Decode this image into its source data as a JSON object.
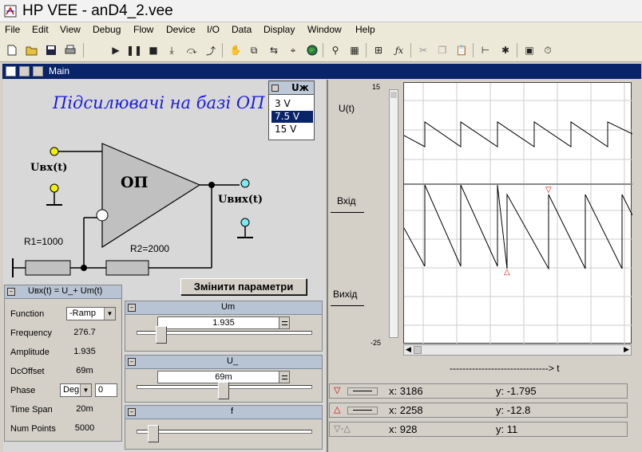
{
  "app": {
    "title": "HP VEE - anD4_2.vee"
  },
  "menu": [
    "File",
    "Edit",
    "View",
    "Debug",
    "Flow",
    "Device",
    "I/O",
    "Data",
    "Display",
    "Window",
    "Help"
  ],
  "window": {
    "title": "Main"
  },
  "schematic": {
    "title": "Підсилювачі на базі ОП",
    "opamp_label": "ОП",
    "uin_label": "Uвх(t)",
    "uout_label": "Uвих(t)",
    "r1_label": "R1=1000",
    "r2_label": "R2=2000"
  },
  "listbox": {
    "title": "Uж",
    "options": [
      "3 V",
      "7.5 V",
      "15 V"
    ],
    "selected": "7.5 V"
  },
  "change_button": "Змінити параметри",
  "function_gen": {
    "title": "Uвх(t) = U_+ Um(t)",
    "rows": [
      {
        "label": "Function",
        "value": "-Ramp"
      },
      {
        "label": "Frequency",
        "value": "276.7"
      },
      {
        "label": "Amplitude",
        "value": "1.935"
      },
      {
        "label": "DcOffset",
        "value": "69m"
      },
      {
        "label": "Phase",
        "unit": "Deg",
        "value": "0"
      },
      {
        "label": "Time Span",
        "value": "20m"
      },
      {
        "label": "Num Points",
        "value": "5000"
      }
    ]
  },
  "sliders": [
    {
      "title": "Um",
      "value": "1.935",
      "level": 0.22
    },
    {
      "title": "U_",
      "value": "69m",
      "level": 0.5
    },
    {
      "title": "f",
      "value": "",
      "level": 0.12
    }
  ],
  "graph": {
    "y_max": "15",
    "y_min": "-25",
    "trace_labels": [
      "U(t)",
      "Вхід",
      "Вихід"
    ],
    "x_axis_label": "-------------------------------> t"
  },
  "markers": [
    {
      "symbol": "▽",
      "x": "x: 3186",
      "y": "y: -1.795"
    },
    {
      "symbol": "△",
      "x": "x: 2258",
      "y": "y: -12.8"
    },
    {
      "symbol": "▽-△",
      "x": "x: 928",
      "y": "y: 11"
    }
  ]
}
